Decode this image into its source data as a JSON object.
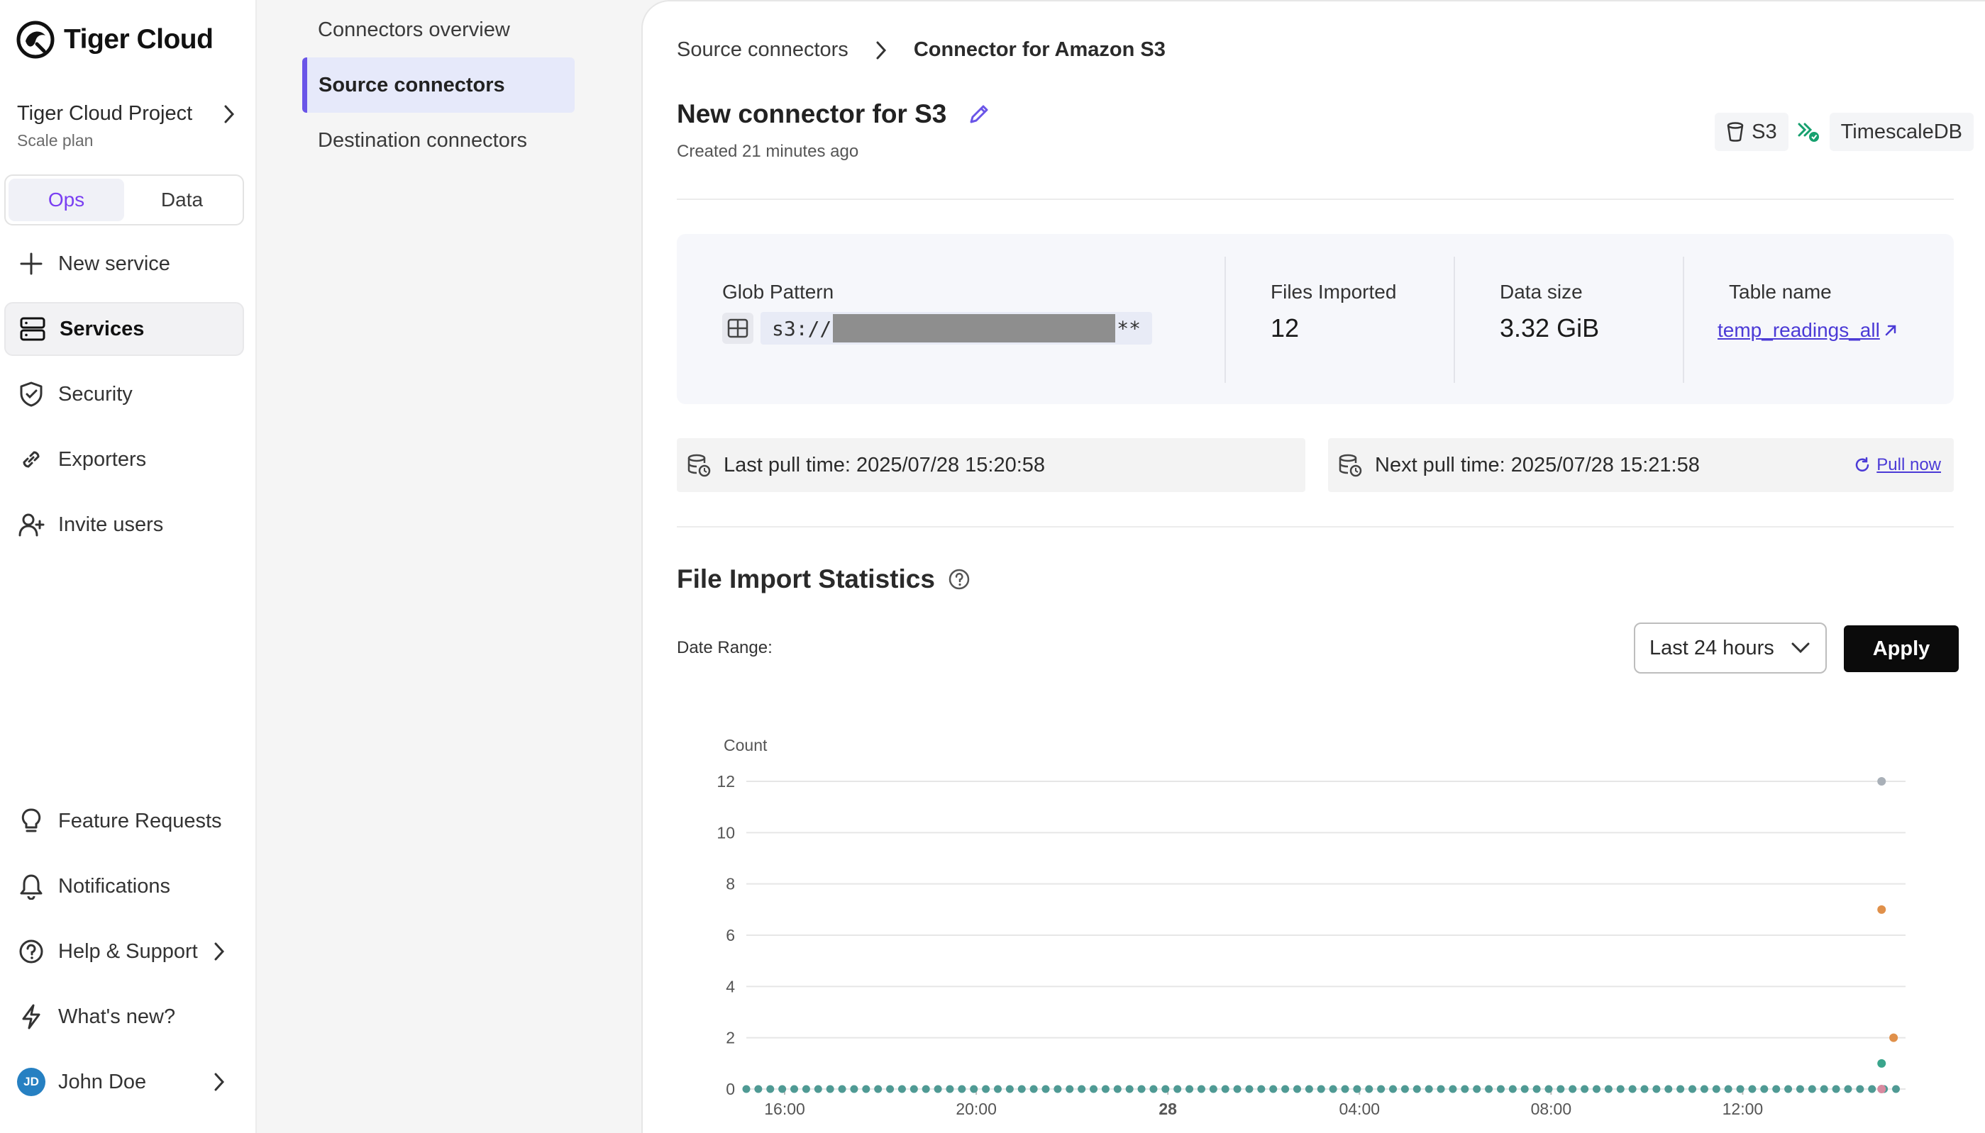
{
  "brand": {
    "name": "Tiger Cloud"
  },
  "project": {
    "name": "Tiger Cloud Project",
    "plan": "Scale plan"
  },
  "mode_tabs": [
    {
      "label": "Ops",
      "active": true
    },
    {
      "label": "Data",
      "active": false
    }
  ],
  "sidebar": {
    "items": [
      {
        "label": "New service",
        "icon": "plus-icon"
      },
      {
        "label": "Services",
        "icon": "services-icon",
        "active": true
      },
      {
        "label": "Security",
        "icon": "shield-icon"
      },
      {
        "label": "Exporters",
        "icon": "link-icon"
      },
      {
        "label": "Invite users",
        "icon": "add-user-icon"
      }
    ],
    "bottom": [
      {
        "label": "Feature Requests",
        "icon": "lightbulb-icon"
      },
      {
        "label": "Notifications",
        "icon": "bell-icon"
      },
      {
        "label": "Help & Support",
        "icon": "help-icon"
      },
      {
        "label": "What's new?",
        "icon": "lightning-icon"
      }
    ],
    "user": {
      "name": "John Doe",
      "initials": "JD"
    }
  },
  "subnav": {
    "items": [
      {
        "label": "Connectors overview"
      },
      {
        "label": "Source connectors",
        "active": true
      },
      {
        "label": "Destination connectors"
      }
    ]
  },
  "breadcrumb": {
    "parent": "Source connectors",
    "current": "Connector for Amazon S3"
  },
  "connector": {
    "title": "New connector for S3",
    "created": "Created 21 minutes ago",
    "source_badge": "S3",
    "destination_badge": "TimescaleDB"
  },
  "stats": {
    "glob_label": "Glob Pattern",
    "glob_prefix": "s3://",
    "glob_suffix": "**",
    "files_label": "Files Imported",
    "files_value": "12",
    "size_label": "Data size",
    "size_value": "3.32 GiB",
    "table_label": "Table name",
    "table_value": "temp_readings_all"
  },
  "pull": {
    "last": "Last pull time: 2025/07/28 15:20:58",
    "next": "Next pull time: 2025/07/28 15:21:58",
    "pull_now": "Pull now"
  },
  "import_stats": {
    "title": "File Import Statistics",
    "date_range_label": "Date Range:",
    "range_value": "Last 24 hours",
    "apply_label": "Apply"
  },
  "colors": {
    "accent": "#7a3ff2",
    "link": "#4b3ad6",
    "teal": "#4f9a94",
    "orange": "#e0904a",
    "green": "#3aa58c",
    "grey": "#a9b0b8"
  },
  "chart_data": {
    "type": "scatter",
    "ylabel": "Count",
    "ylim": [
      0,
      12
    ],
    "yticks": [
      0,
      2,
      4,
      6,
      8,
      10,
      12
    ],
    "x_tick_labels": [
      "16:00",
      "20:00",
      "28",
      "04:00",
      "08:00",
      "12:00"
    ],
    "x_range_hours": [
      -0.8,
      23.4
    ],
    "x_tick_hours": [
      0,
      4,
      8,
      12,
      16,
      20
    ],
    "baseline": {
      "from_hour": -0.8,
      "to_hour": 23.4,
      "step_hours": 0.25,
      "value": 0,
      "color": "#4f9a94"
    },
    "series": [
      {
        "color": "#a9b0b8",
        "points": [
          [
            22.9,
            12
          ]
        ]
      },
      {
        "color": "#e0904a",
        "points": [
          [
            22.9,
            7
          ],
          [
            23.15,
            2
          ]
        ]
      },
      {
        "color": "#3aa58c",
        "points": [
          [
            22.9,
            1
          ]
        ]
      },
      {
        "color": "#d98aa0",
        "points": [
          [
            22.9,
            0
          ]
        ]
      }
    ]
  }
}
